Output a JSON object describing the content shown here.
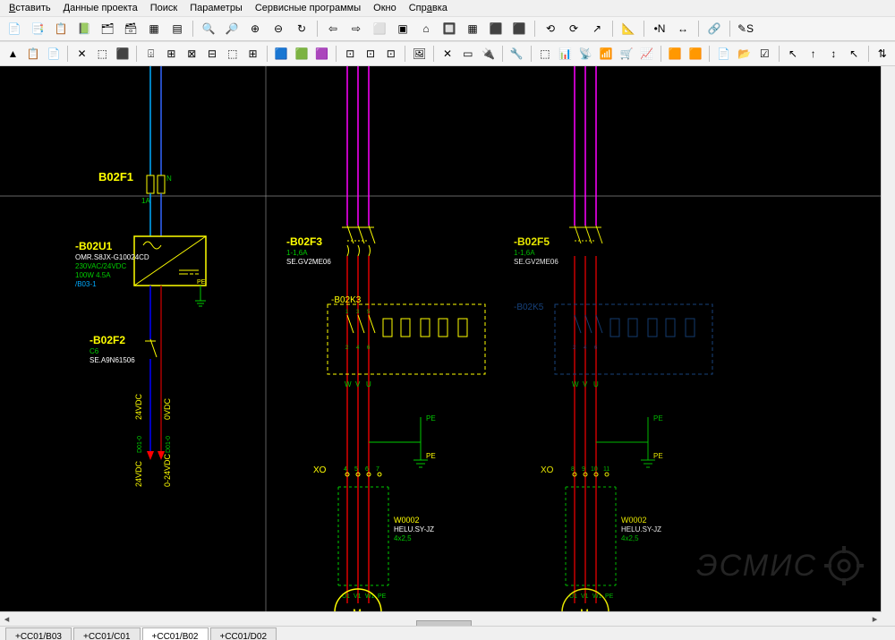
{
  "menu": {
    "items": [
      "Вставить",
      "Данные проекта",
      "Поиск",
      "Параметры",
      "Сервисные программы",
      "Окно",
      "Справка"
    ]
  },
  "toolbars": {
    "row1_icons": [
      "📄",
      "📑",
      "📋",
      "📗",
      "🗂",
      "🗃",
      "▦",
      "▤",
      "",
      "🔍",
      "🔎",
      "⊕",
      "⊖",
      "↻",
      "",
      "⇦",
      "⇨",
      "⬜",
      "▣",
      "⌂",
      "🔲",
      "▦",
      "⬛",
      "⬛",
      "",
      "⟲",
      "⟳",
      "↗",
      "",
      "📐",
      "",
      "•N",
      "↔",
      "",
      "🔗",
      "",
      "✎S"
    ],
    "row2_icons": [
      "▲",
      "📋",
      "📄",
      "",
      "✕",
      "⬚",
      "⬛",
      "",
      "⌹",
      "⊞",
      "⊠",
      "⊟",
      "⬚",
      "⊞",
      "",
      "🟦",
      "🟩",
      "🟪",
      "",
      "⊡",
      "⊡",
      "⊡",
      "",
      "🖼",
      "",
      "✕",
      "▭",
      "🔌",
      "",
      "🔧",
      "",
      "⬚",
      "📊",
      "📡",
      "📶",
      "🛒",
      "📈",
      "",
      "🟧",
      "🟧",
      "",
      "📄",
      "📂",
      "☑",
      "",
      "↖",
      "↑",
      "↕",
      "↖",
      "",
      "⇅"
    ]
  },
  "tabs": [
    "+CC01/B03",
    "+CC01/C01",
    "+CC01/B02",
    "+CC01/D02"
  ],
  "schematic": {
    "topnode": "B02F1",
    "top_left_ia": "1A",
    "top_right_n": "N",
    "u1": {
      "ref": "-B02U1",
      "part": "OMR.S8JX-G10024CD",
      "rating": "230VAC/24VDC",
      "power": "100W 4.5A",
      "xref": "/B03-1",
      "pe": "PE"
    },
    "f2": {
      "ref": "-B02F2",
      "rating": "C6",
      "part": "SE.A9N61506"
    },
    "rails": {
      "v24": "24VDC",
      "v0": "0VDC",
      "d01_0": "D01-0",
      "d01_1": "D01-0",
      "l24": "24VDC",
      "l0": "0-24VDC"
    },
    "f3": {
      "ref": "-B02F3",
      "rating": "1-1,6A",
      "part": "SE.GV2ME06"
    },
    "f5": {
      "ref": "-B02F5",
      "rating": "1-1,6A",
      "part": "SE.GV2ME06"
    },
    "k3": {
      "ref": "-B02K3"
    },
    "k5": {
      "ref": "-B02K5"
    },
    "xo": {
      "label": "XO",
      "pins_a": [
        "4",
        "5",
        "6",
        "7"
      ],
      "pins_b": [
        "8",
        "9",
        "10",
        "11"
      ],
      "pe": "PE"
    },
    "cable": {
      "ref": "W0002",
      "type": "HELU.SY-JZ",
      "spec": "4x2,5"
    },
    "motor": {
      "u": "U1",
      "v": "V1",
      "w": "W1",
      "pe": "PE"
    },
    "busW": "W",
    "busV": "V",
    "busU": "U",
    "busPE": "PE"
  },
  "watermark": "ЭСМИС"
}
